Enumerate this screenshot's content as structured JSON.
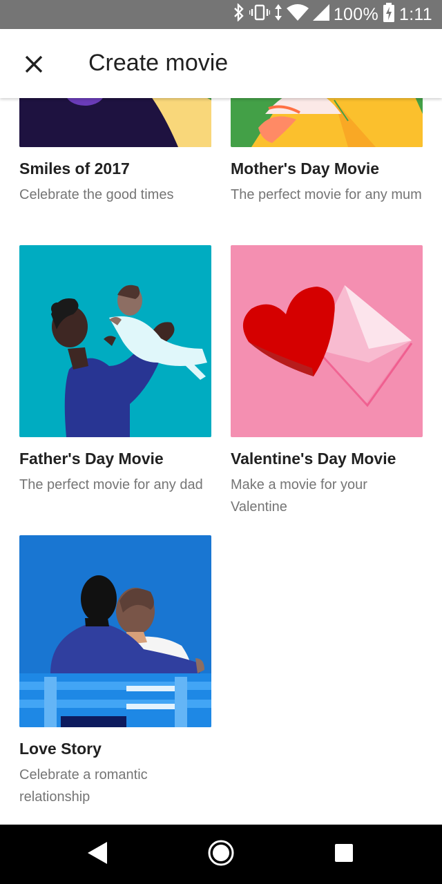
{
  "status_bar": {
    "battery": "100%",
    "time": "1:11",
    "icons": [
      "bluetooth-icon",
      "vibrate-icon",
      "data-arrows-icon",
      "wifi-icon",
      "cell-signal-icon",
      "battery-charging-icon"
    ]
  },
  "app_bar": {
    "title": "Create movie",
    "close_icon": "close-icon"
  },
  "cards": [
    {
      "name": "Smiles of 2017",
      "description": "Celebrate the good times"
    },
    {
      "name": "Mother's Day Movie",
      "description": "The perfect movie for any mum"
    },
    {
      "name": "Father's Day Movie",
      "description": "The perfect movie for any dad"
    },
    {
      "name": "Valentine's Day Movie",
      "description": "Make a movie for your Valentine"
    },
    {
      "name": "Love Story",
      "description": "Celebrate a romantic relationship"
    }
  ],
  "nav_bar": {
    "back_icon": "back-triangle-icon",
    "home_icon": "home-circle-icon",
    "recents_icon": "recents-square-icon"
  }
}
